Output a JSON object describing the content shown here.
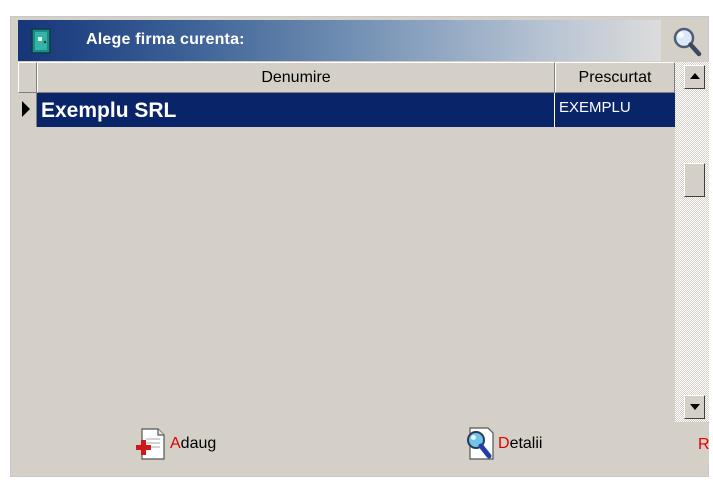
{
  "header": {
    "title": "Alege firma curenta:",
    "icon": "door-icon",
    "search_icon": "magnifier-icon"
  },
  "grid": {
    "columns": [
      "Denumire",
      "Prescurtat"
    ],
    "rows": [
      {
        "denumire": "Exemplu SRL",
        "prescurtat": "EXEMPLU",
        "selected": true
      }
    ],
    "selection_color": "#0a246a"
  },
  "footer": {
    "add": {
      "accel": "A",
      "rest": "daug",
      "icon": "add-document-icon"
    },
    "details": {
      "accel": "D",
      "rest": "etalii",
      "icon": "details-search-icon"
    },
    "r_label": "R",
    "accent_color": "#e00000"
  }
}
